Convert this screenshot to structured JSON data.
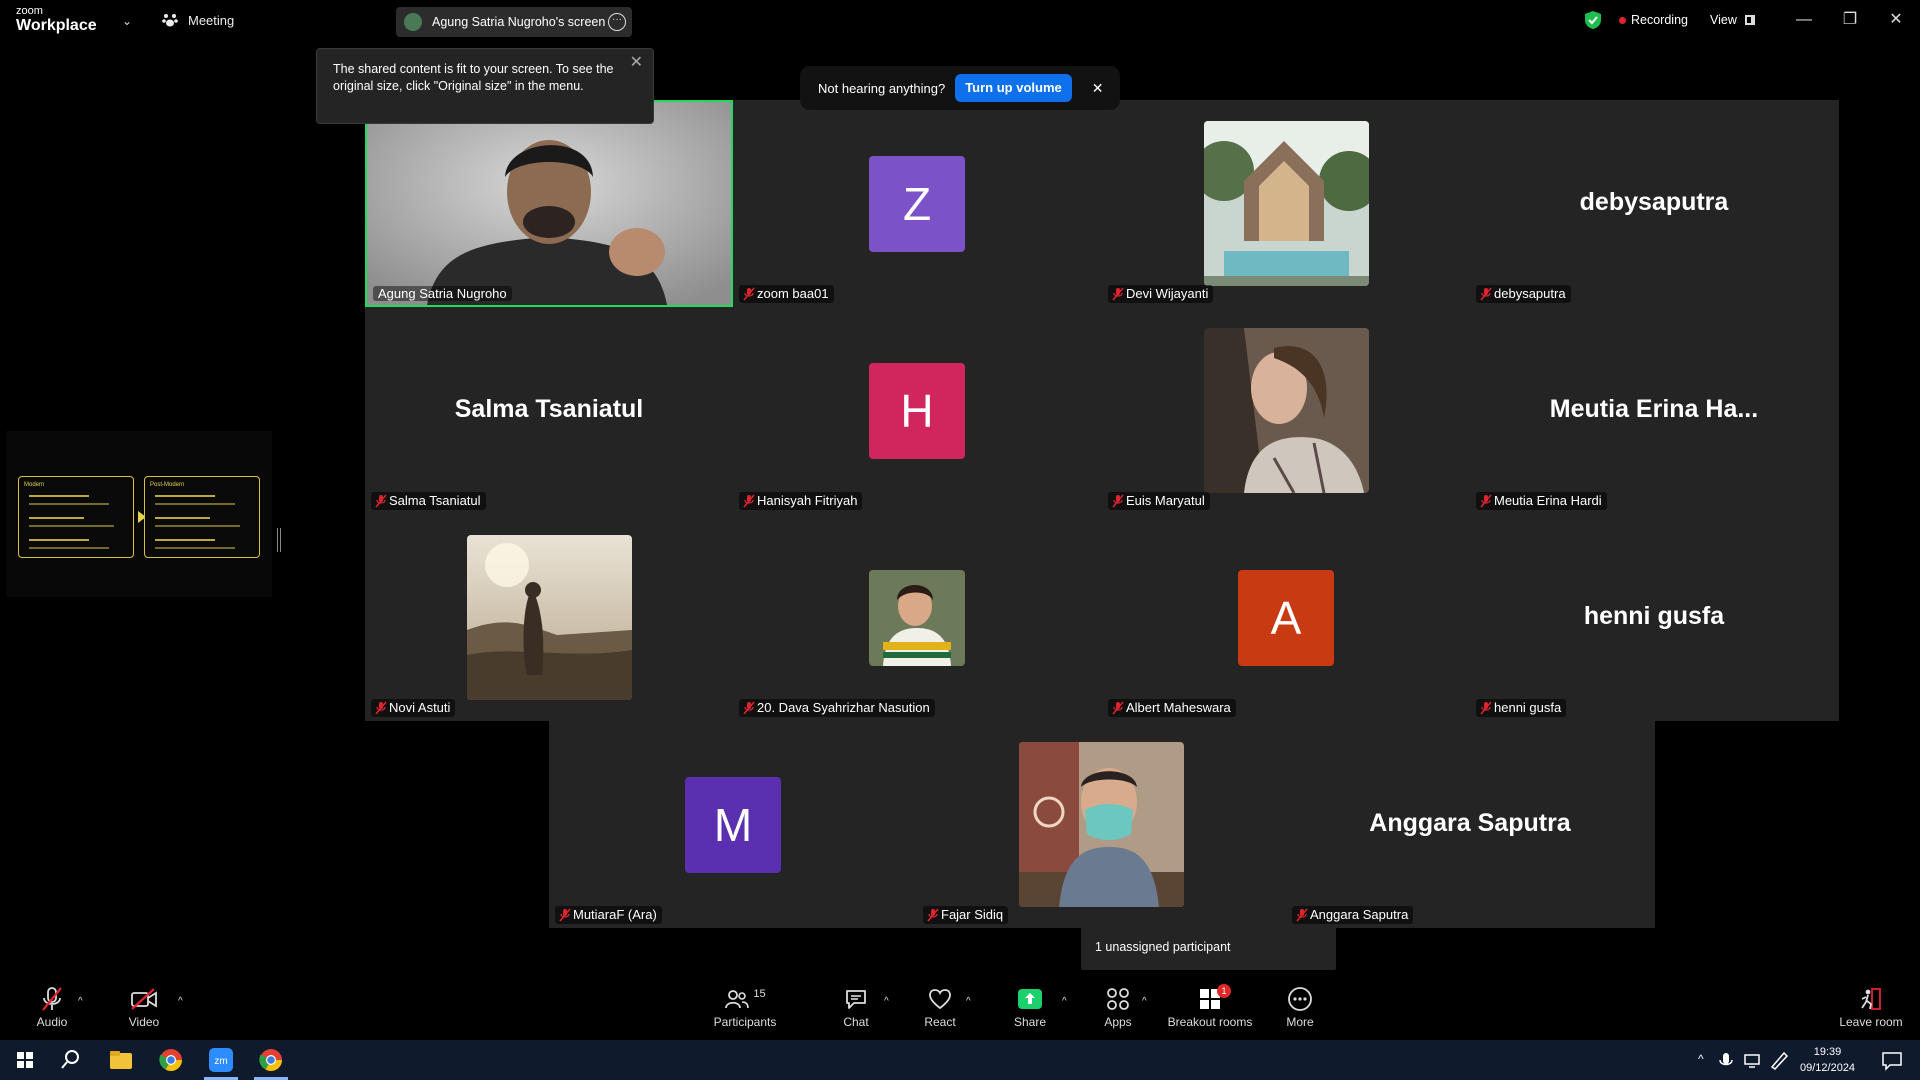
{
  "app": {
    "logo_small": "zoom",
    "logo_big": "Workplace",
    "meeting_label": "Meeting",
    "share_pill_label": "Agung Satria Nugroho's screen",
    "recording_label": "Recording",
    "view_label": "View"
  },
  "tooltip": {
    "text": "The shared content is fit to your screen. To see the original size, click \"Original size\" in the menu."
  },
  "volume_toast": {
    "text": "Not hearing anything?",
    "button": "Turn up volume"
  },
  "participants": [
    {
      "name": "Agung Satria Nugroho",
      "kind": "video"
    },
    {
      "name": "zoom baa01",
      "kind": "initial",
      "initial": "Z",
      "color": "#7c52c8"
    },
    {
      "name": "Devi Wijayanti",
      "kind": "photo",
      "photo": "house"
    },
    {
      "name": "debysaputra",
      "kind": "text",
      "display": "debysaputra"
    },
    {
      "name": "Salma Tsaniatul",
      "kind": "text",
      "display": "Salma Tsaniatul"
    },
    {
      "name": "Hanisyah Fitriyah",
      "kind": "initial",
      "initial": "H",
      "color": "#d1255d"
    },
    {
      "name": "Euis Maryatul",
      "kind": "photo",
      "photo": "woman"
    },
    {
      "name": "Meutia Erina Hardi",
      "kind": "text",
      "display": "Meutia Erina Ha..."
    },
    {
      "name": "Novi Astuti",
      "kind": "photo",
      "photo": "landscape"
    },
    {
      "name": "20. Dava Syahrizhar Nasution",
      "kind": "photo",
      "photo": "boy"
    },
    {
      "name": "Albert Maheswara",
      "kind": "initial",
      "initial": "A",
      "color": "#c83a12"
    },
    {
      "name": "henni gusfa",
      "kind": "text",
      "display": "henni gusfa"
    },
    {
      "name": "MutiaraF (Ara)",
      "kind": "initial",
      "initial": "M",
      "color": "#5a2fb0"
    },
    {
      "name": "Fajar Sidiq",
      "kind": "photo",
      "photo": "man-mask"
    },
    {
      "name": "Anggara Saputra",
      "kind": "text",
      "display": "Anggara Saputra"
    }
  ],
  "slide_thumb": {
    "left_title": "Modern",
    "right_title": "Post-Modern"
  },
  "unassigned_text": "1 unassigned participant",
  "toolbar": {
    "audio": "Audio",
    "video": "Video",
    "participants": "Participants",
    "participants_count": "15",
    "chat": "Chat",
    "react": "React",
    "share": "Share",
    "apps": "Apps",
    "breakout": "Breakout rooms",
    "breakout_badge": "1",
    "more": "More",
    "leave": "Leave room"
  },
  "taskbar": {
    "time": "19:39",
    "date": "09/12/2024"
  },
  "colors": {
    "accent": "#0e71eb",
    "active_speaker": "#23d959",
    "share_green": "#1cd16b",
    "record_red": "#e0242e"
  }
}
